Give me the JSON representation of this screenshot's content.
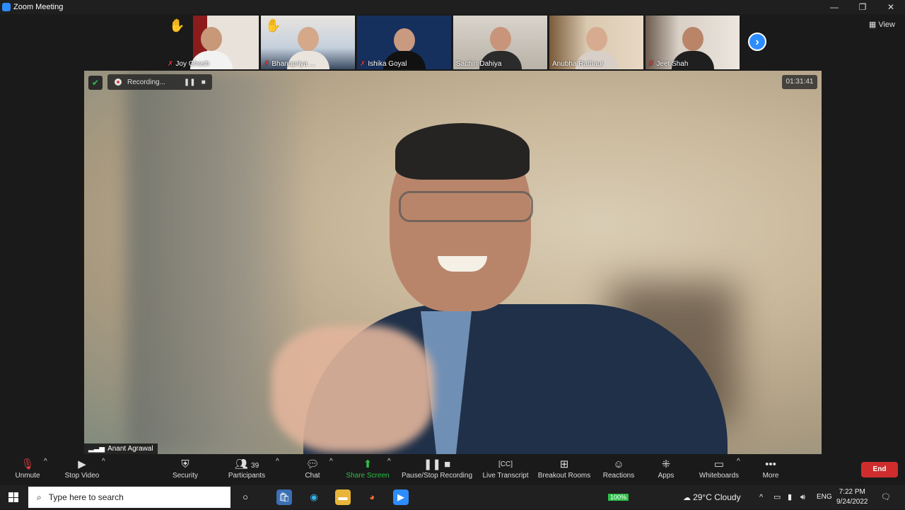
{
  "window": {
    "title": "Zoom Meeting",
    "view_label": "View"
  },
  "participants_strip": [
    {
      "name": "Joy Ghosh",
      "hand_raised": true
    },
    {
      "name": "Bhanupriya ...",
      "hand_raised": true
    },
    {
      "name": "Ishika Goyal",
      "hand_raised": false
    },
    {
      "name": "Sachin Dahiya",
      "hand_raised": false
    },
    {
      "name": "Anubha Rathaur",
      "hand_raised": false
    },
    {
      "name": "Jeet Shah",
      "hand_raised": false
    }
  ],
  "recording": {
    "label": "Recording..."
  },
  "meeting_timer": "01:31:41",
  "active_speaker": "Anant Agrawal",
  "toolbar": {
    "unmute": "Unmute",
    "stop_video": "Stop Video",
    "security": "Security",
    "participants": "Participants",
    "participants_count": "39",
    "chat": "Chat",
    "share_screen": "Share Screen",
    "pause_stop_recording": "Pause/Stop Recording",
    "live_transcript": "Live Transcript",
    "breakout_rooms": "Breakout Rooms",
    "reactions": "Reactions",
    "apps": "Apps",
    "whiteboards": "Whiteboards",
    "more": "More",
    "end": "End"
  },
  "taskbar": {
    "search_placeholder": "Type here to search",
    "battery": "100%",
    "weather": "29°C  Cloudy",
    "language": "ENG",
    "time": "7:22 PM",
    "date": "9/24/2022"
  },
  "colors": {
    "accent": "#2d8cff",
    "end": "#cf2d2d",
    "share": "#2fbf4a"
  }
}
